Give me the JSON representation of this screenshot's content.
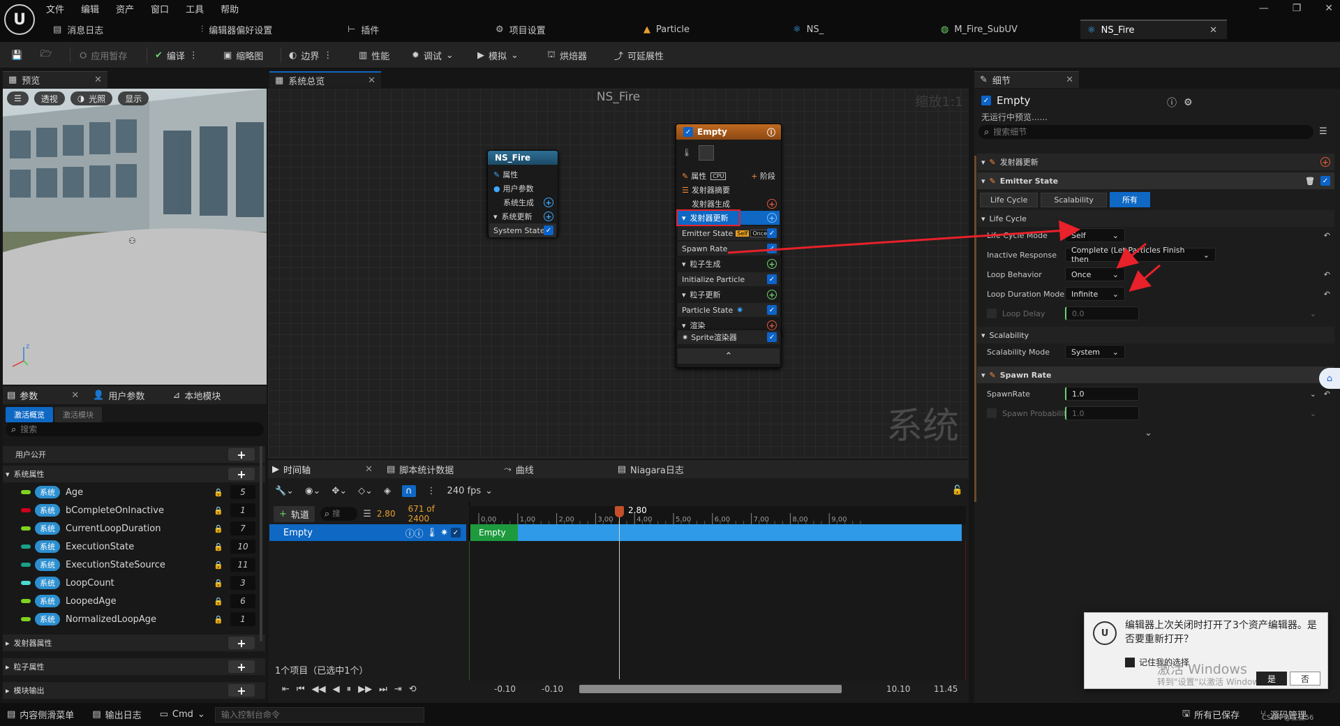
{
  "menu": [
    "文件",
    "编辑",
    "资产",
    "窗口",
    "工具",
    "帮助"
  ],
  "window_controls": {
    "minimize": "—",
    "restore": "❐",
    "close": "✕"
  },
  "tabs": [
    {
      "label": "消息日志",
      "icon": "message-log-icon"
    },
    {
      "label": "编辑器偏好设置",
      "icon": "sliders-icon"
    },
    {
      "label": "插件",
      "icon": "plug-icon"
    },
    {
      "label": "项目设置",
      "icon": "gear-icon"
    },
    {
      "label": "Particle",
      "icon": "particle-icon"
    },
    {
      "label": "NS_",
      "icon": "niagara-icon"
    },
    {
      "label": "M_Fire_SubUV",
      "icon": "material-icon"
    },
    {
      "label": "NS_Fire",
      "icon": "niagara-icon",
      "close": "✕"
    }
  ],
  "toolbar": {
    "apply_pause": "应用暂存",
    "compile": "编译",
    "thumbnail": "缩略图",
    "bounds": "边界",
    "performance": "性能",
    "debug": "调试",
    "simulate": "模拟",
    "bake": "烘焙器",
    "scalability": "可延展性"
  },
  "preview": {
    "tab": "预览",
    "btn_perspective": "透视",
    "btn_lighting": "光照",
    "btn_show": "显示"
  },
  "params": {
    "tab_params": "参数",
    "tab_user": "用户参数",
    "tab_local": "本地模块",
    "sub_active": "激活概览",
    "sub_modules": "激活模块",
    "search_placeholder": "搜索",
    "user_exposed": "用户公开",
    "system_attrs": "系统属性",
    "tag": "系统",
    "items": [
      {
        "name": "Age",
        "value": "5",
        "color": "#7ed321"
      },
      {
        "name": "bCompleteOnInactive",
        "value": "1",
        "color": "#d0021b"
      },
      {
        "name": "CurrentLoopDuration",
        "value": "7",
        "color": "#7ed321"
      },
      {
        "name": "ExecutionState",
        "value": "10",
        "color": "#1aa089"
      },
      {
        "name": "ExecutionStateSource",
        "value": "11",
        "color": "#1aa089"
      },
      {
        "name": "LoopCount",
        "value": "3",
        "color": "#4bd9d0"
      },
      {
        "name": "LoopedAge",
        "value": "6",
        "color": "#7ed321"
      },
      {
        "name": "NormalizedLoopAge",
        "value": "1",
        "color": "#7ed321"
      }
    ],
    "emitter_attrs": "发射器属性",
    "particle_attrs": "粒子属性",
    "module_outputs": "模块输出"
  },
  "graph": {
    "tab": "系统总览",
    "title": "NS_Fire",
    "zoom": "缩放1:1",
    "watermark": "系统",
    "system_node": {
      "title": "NS_Fire",
      "props": "属性",
      "user_params": "用户参数",
      "spawn": "系统生成",
      "update": "系统更新",
      "state": "System State"
    },
    "emitter_node": {
      "title": "Empty",
      "props": "属性",
      "cpu": "CPU",
      "stage": "阶段",
      "summary": "发射器摘要",
      "spawn": "发射器生成",
      "update": "发射器更新",
      "emitter_state": "Emitter State",
      "tag_self": "Self",
      "tag_once": "Once",
      "spawn_rate": "Spawn Rate",
      "particle_spawn": "粒子生成",
      "init_particle": "Initialize Particle",
      "particle_update": "粒子更新",
      "particle_state": "Particle State",
      "render": "渲染",
      "sprite": "Sprite渲染器"
    }
  },
  "details": {
    "tab": "细节",
    "name": "Empty",
    "subtitle": "无运行中预览......",
    "search_placeholder": "搜索细节",
    "emitter_update": "发射器更新",
    "emitter_state": "Emitter State",
    "filters": [
      "Life Cycle",
      "Scalability",
      "所有"
    ],
    "life_cycle": "Life Cycle",
    "rows": [
      {
        "label": "Life Cycle Mode",
        "value": "Self"
      },
      {
        "label": "Inactive Response",
        "value": "Complete (Let Particles Finish then"
      },
      {
        "label": "Loop Behavior",
        "value": "Once"
      },
      {
        "label": "Loop Duration Mode",
        "value": "Infinite"
      },
      {
        "label": "Loop Delay",
        "value": "0.0"
      }
    ],
    "scalability": "Scalability",
    "scal_mode_label": "Scalability Mode",
    "scal_mode_value": "System",
    "spawn_rate": "Spawn Rate",
    "spawnrate_label": "SpawnRate",
    "spawnrate_value": "1.0",
    "spawn_prob_label": "Spawn Probability",
    "spawn_prob_value": "1.0"
  },
  "timeline": {
    "tab_timeline": "时间轴",
    "tab_stats": "脚本统计数据",
    "tab_curves": "曲线",
    "tab_log": "Niagara日志",
    "fps": "240 fps",
    "track_btn": "轨道",
    "search_placeholder": "搜",
    "current_time": "2.80",
    "frame": "671 of 2400",
    "track_name": "Empty",
    "bar_label": "Empty",
    "playhead_label": "2.80",
    "ticks": [
      "0.00",
      "1.00",
      "2.00",
      "3.00",
      "4.00",
      "5.00",
      "6.00",
      "7.00",
      "8.00",
      "9.00"
    ],
    "items_count": "1个项目（已选中1个）",
    "range_start": "-0.10",
    "range_start2": "-0.10",
    "range_end": "10.10",
    "range_end2": "11.45"
  },
  "status": {
    "drawer": "内容侧滑菜单",
    "output_log": "输出日志",
    "cmd": "Cmd",
    "console_placeholder": "输入控制台命令",
    "saved": "所有已保存",
    "source_control": "源码管理",
    "extra": "CSDN @主狂56"
  },
  "toast": {
    "message": "编辑器上次关闭时打开了3个资产编辑器。是否要重新打开？",
    "remember": "记住我的选择",
    "yes": "是",
    "no": "否",
    "activate_title": "激活 Windows",
    "activate_sub": "转到\"设置\"以激活 Windows。"
  },
  "annotation_color": "#e8212a"
}
